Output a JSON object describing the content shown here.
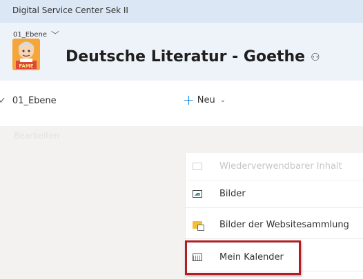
{
  "topbar": {
    "title": "Digital Service Center Sek II"
  },
  "header": {
    "breadcrumb": "01_Ebene",
    "breadcrumb_chevron": "chevron-down-icon",
    "site_title": "Deutsche Literatur - Goethe",
    "teams_icon": "teams-icon"
  },
  "left_nav": {
    "items": [
      {
        "label": "01_Ebene",
        "icon": "checkmark-icon"
      }
    ],
    "edit_label": "Bearbeiten"
  },
  "command_bar": {
    "new_label": "Neu",
    "new_icon": "plus-icon",
    "new_chevron": "chevron-down-icon"
  },
  "menu": {
    "items": [
      {
        "label": "Wiederverwendbarer Inhalt",
        "icon": "reusable-content-icon"
      },
      {
        "label": "Bilder",
        "icon": "image-library-icon"
      },
      {
        "label": "Bilder der Websitesammlung",
        "icon": "site-collection-images-icon"
      },
      {
        "label": "Mein Kalender",
        "icon": "calendar-icon"
      }
    ]
  },
  "colors": {
    "accent": "#0078d4",
    "highlight": "#b01d23",
    "header_bg": "#eef3fa",
    "topbar_bg": "#dbe7f4"
  }
}
